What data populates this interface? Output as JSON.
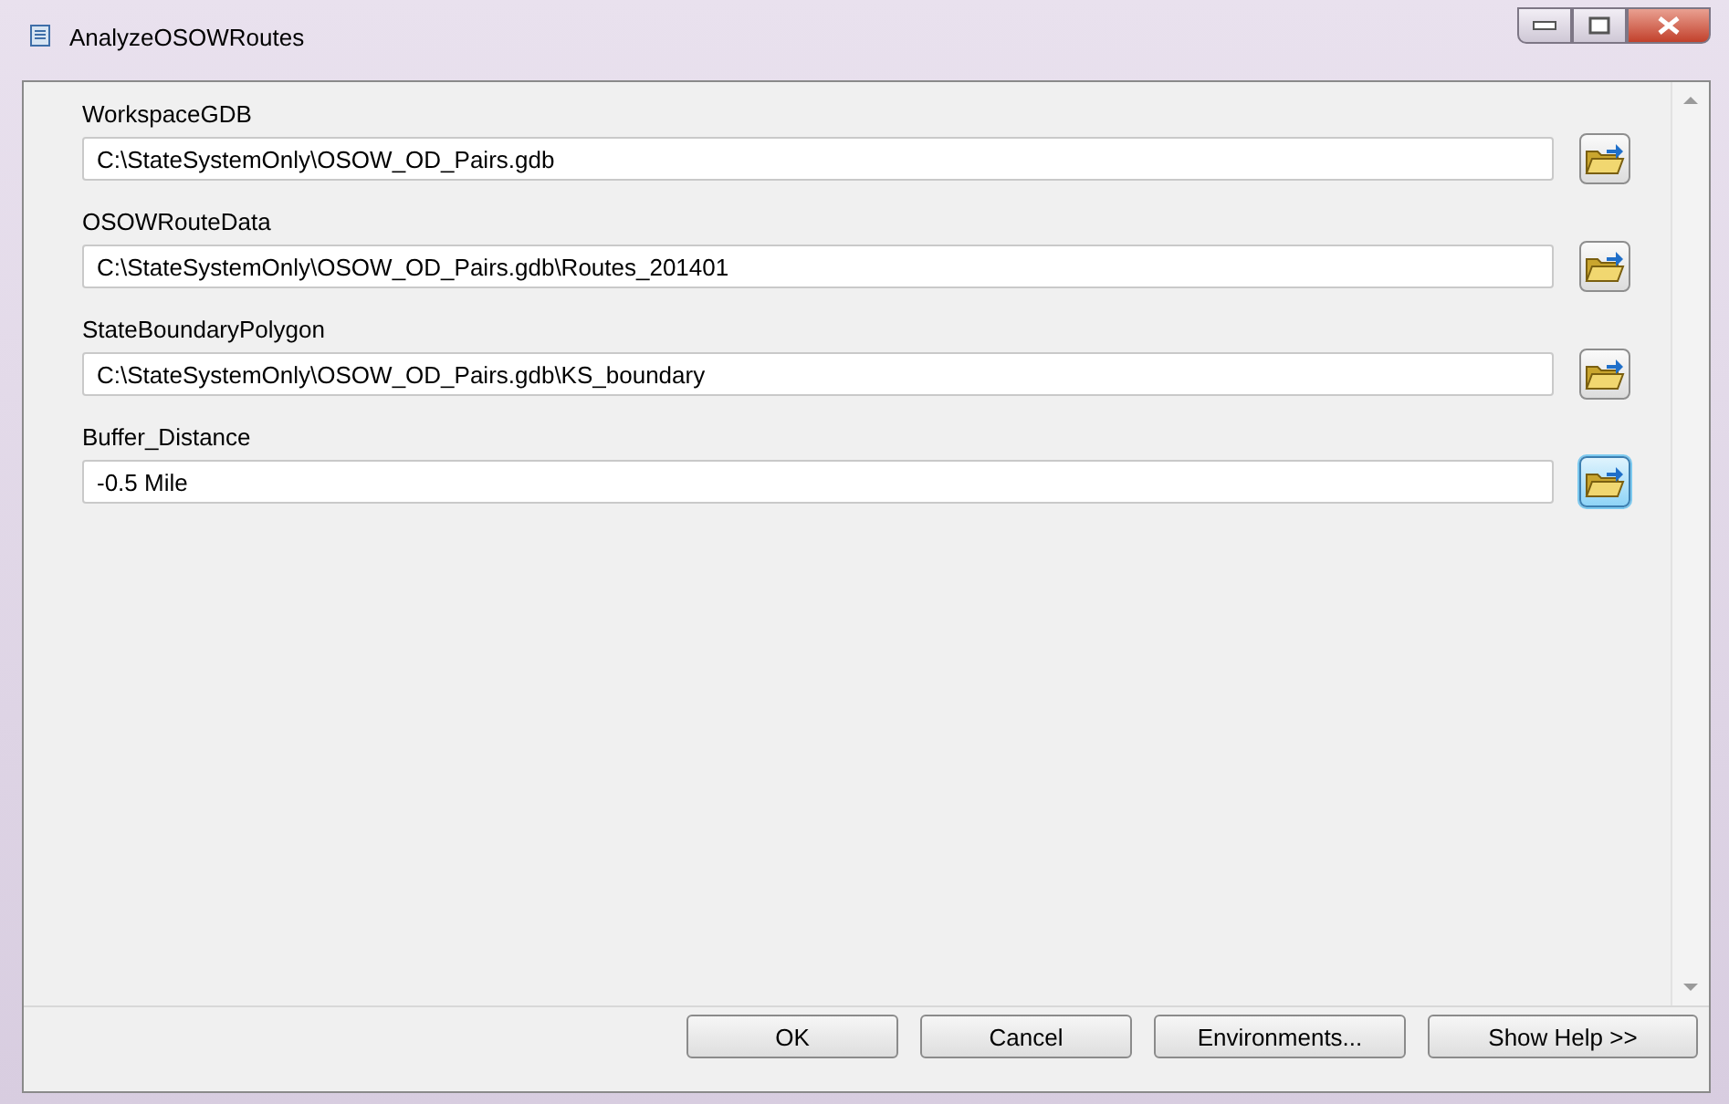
{
  "window": {
    "title": "AnalyzeOSOWRoutes"
  },
  "parameters": [
    {
      "label": "WorkspaceGDB",
      "value": "C:\\StateSystemOnly\\OSOW_OD_Pairs.gdb",
      "highlighted": false
    },
    {
      "label": "OSOWRouteData",
      "value": "C:\\StateSystemOnly\\OSOW_OD_Pairs.gdb\\Routes_201401",
      "highlighted": false
    },
    {
      "label": "StateBoundaryPolygon",
      "value": "C:\\StateSystemOnly\\OSOW_OD_Pairs.gdb\\KS_boundary",
      "highlighted": false
    },
    {
      "label": "Buffer_Distance",
      "value": "-0.5 Mile",
      "highlighted": true
    }
  ],
  "buttons": [
    "OK",
    "Cancel",
    "Environments...",
    "Show Help >>"
  ]
}
